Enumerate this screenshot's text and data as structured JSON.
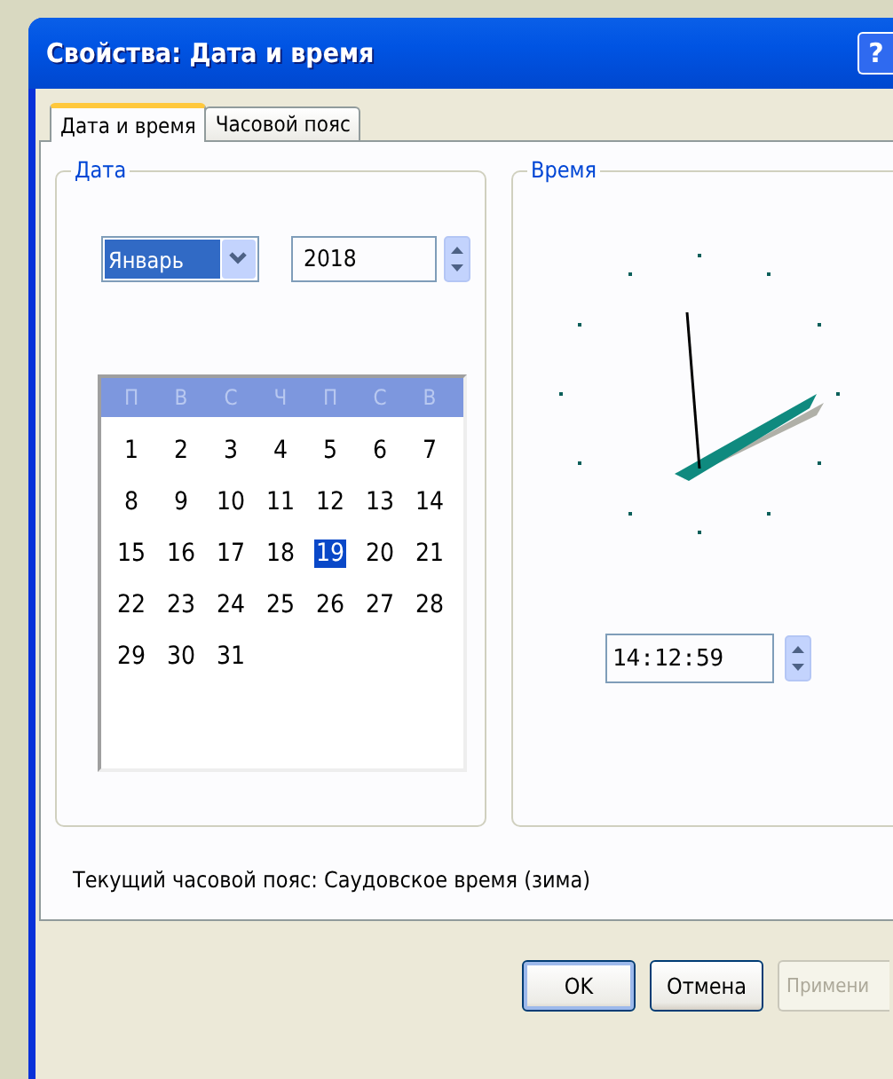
{
  "window": {
    "title": "Свойства: Дата и время",
    "help_button": "?"
  },
  "tabs": [
    {
      "label": "Дата и время",
      "selected": true
    },
    {
      "label": "Часовой пояс",
      "selected": false
    }
  ],
  "date_group": {
    "label": "Дата",
    "month": "Январь",
    "year": "2018",
    "weekdays": [
      "П",
      "В",
      "С",
      "Ч",
      "П",
      "С",
      "В"
    ],
    "days": [
      {
        "label": "1",
        "selected": false
      },
      {
        "label": "2",
        "selected": false
      },
      {
        "label": "3",
        "selected": false
      },
      {
        "label": "4",
        "selected": false
      },
      {
        "label": "5",
        "selected": false
      },
      {
        "label": "6",
        "selected": false
      },
      {
        "label": "7",
        "selected": false
      },
      {
        "label": "8",
        "selected": false
      },
      {
        "label": "9",
        "selected": false
      },
      {
        "label": "10",
        "selected": false
      },
      {
        "label": "11",
        "selected": false
      },
      {
        "label": "12",
        "selected": false
      },
      {
        "label": "13",
        "selected": false
      },
      {
        "label": "14",
        "selected": false
      },
      {
        "label": "15",
        "selected": false
      },
      {
        "label": "16",
        "selected": false
      },
      {
        "label": "17",
        "selected": false
      },
      {
        "label": "18",
        "selected": false
      },
      {
        "label": "19",
        "selected": true
      },
      {
        "label": "20",
        "selected": false
      },
      {
        "label": "21",
        "selected": false
      },
      {
        "label": "22",
        "selected": false
      },
      {
        "label": "23",
        "selected": false
      },
      {
        "label": "24",
        "selected": false
      },
      {
        "label": "25",
        "selected": false
      },
      {
        "label": "26",
        "selected": false
      },
      {
        "label": "27",
        "selected": false
      },
      {
        "label": "28",
        "selected": false
      },
      {
        "label": "29",
        "selected": false
      },
      {
        "label": "30",
        "selected": false
      },
      {
        "label": "31",
        "selected": false
      }
    ]
  },
  "time_group": {
    "label": "Время",
    "time": "14:12:59"
  },
  "timezone_text": "Текущий часовой пояс: Саудовское время (зима)",
  "buttons": [
    {
      "label": "OK",
      "disabled": false
    },
    {
      "label": "Отмена",
      "disabled": false
    },
    {
      "label": "Примени",
      "disabled": true
    }
  ]
}
